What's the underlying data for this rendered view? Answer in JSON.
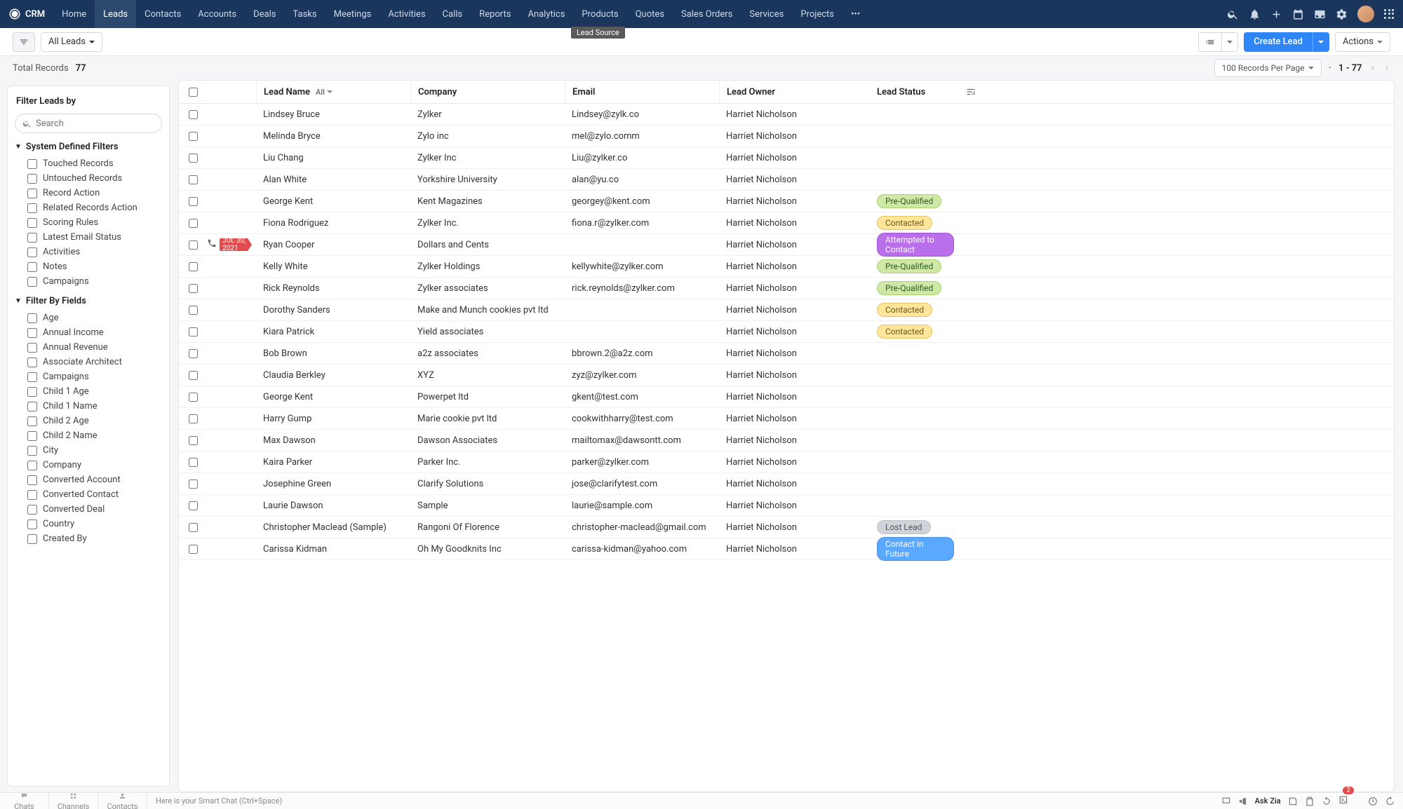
{
  "brand": "CRM",
  "nav": [
    "Home",
    "Leads",
    "Contacts",
    "Accounts",
    "Deals",
    "Tasks",
    "Meetings",
    "Activities",
    "Calls",
    "Reports",
    "Analytics",
    "Products",
    "Quotes",
    "Sales Orders",
    "Services",
    "Projects"
  ],
  "nav_active": 1,
  "tooltip": "Lead Source",
  "toolbar": {
    "view": "All Leads",
    "create": "Create Lead",
    "actions": "Actions"
  },
  "records_label": "Total Records",
  "records_count": "77",
  "perpage": "100 Records Per Page",
  "range": "1 - 77",
  "sidebar": {
    "title": "Filter Leads by",
    "search_placeholder": "Search",
    "group1": "System Defined Filters",
    "group1_items": [
      "Touched Records",
      "Untouched Records",
      "Record Action",
      "Related Records Action",
      "Scoring Rules",
      "Latest Email Status",
      "Activities",
      "Notes",
      "Campaigns"
    ],
    "group2": "Filter By Fields",
    "group2_items": [
      "Age",
      "Annual Income",
      "Annual Revenue",
      "Associate Architect",
      "Campaigns",
      "Child 1 Age",
      "Child 1 Name",
      "Child 2 Age",
      "Child 2 Name",
      "City",
      "Company",
      "Converted Account",
      "Converted Contact",
      "Converted Deal",
      "Country",
      "Created By"
    ]
  },
  "columns": {
    "name": "Lead Name",
    "all": "All",
    "company": "Company",
    "email": "Email",
    "owner": "Lead Owner",
    "status": "Lead Status"
  },
  "rows": [
    {
      "name": "Lindsey Bruce",
      "company": "Zylker",
      "email": "Lindsey@zylk.co",
      "owner": "Harriet Nicholson",
      "status": null
    },
    {
      "name": "Melinda Bryce",
      "company": "Zylo inc",
      "email": "mel@zylo.comm",
      "owner": "Harriet Nicholson",
      "status": null
    },
    {
      "name": "Liu Chang",
      "company": "Zylker Inc",
      "email": "Liu@zylker.co",
      "owner": "Harriet Nicholson",
      "status": null
    },
    {
      "name": "Alan White",
      "company": "Yorkshire University",
      "email": "alan@yu.co",
      "owner": "Harriet Nicholson",
      "status": null
    },
    {
      "name": "George Kent",
      "company": "Kent Magazines",
      "email": "georgey@kent.com",
      "owner": "Harriet Nicholson",
      "status": "Pre-Qualified"
    },
    {
      "name": "Fiona Rodriguez",
      "company": "Zylker Inc.",
      "email": "fiona.r@zylker.com",
      "owner": "Harriet Nicholson",
      "status": "Contacted"
    },
    {
      "name": "Ryan Cooper",
      "company": "Dollars and Cents",
      "email": "",
      "owner": "Harriet Nicholson",
      "status": "Attempted to Contact",
      "flag": "JUL 30, 2021",
      "phone": true
    },
    {
      "name": "Kelly White",
      "company": "Zylker Holdings",
      "email": "kellywhite@zylker.com",
      "owner": "Harriet Nicholson",
      "status": "Pre-Qualified"
    },
    {
      "name": "Rick Reynolds",
      "company": "Zylker associates",
      "email": "rick.reynolds@zylker.com",
      "owner": "Harriet Nicholson",
      "status": "Pre-Qualified"
    },
    {
      "name": "Dorothy Sanders",
      "company": "Make and Munch cookies pvt ltd",
      "email": "",
      "owner": "Harriet Nicholson",
      "status": "Contacted"
    },
    {
      "name": "Kiara Patrick",
      "company": "Yield associates",
      "email": "",
      "owner": "Harriet Nicholson",
      "status": "Contacted"
    },
    {
      "name": "Bob Brown",
      "company": "a2z associates",
      "email": "bbrown.2@a2z.com",
      "owner": "Harriet Nicholson",
      "status": null
    },
    {
      "name": "Claudia Berkley",
      "company": "XYZ",
      "email": "zyz@zylker.com",
      "owner": "Harriet Nicholson",
      "status": null
    },
    {
      "name": "George Kent",
      "company": "Powerpet ltd",
      "email": "gkent@test.com",
      "owner": "Harriet Nicholson",
      "status": null
    },
    {
      "name": "Harry Gump",
      "company": "Marie cookie pvt ltd",
      "email": "cookwithharry@test.com",
      "owner": "Harriet Nicholson",
      "status": null
    },
    {
      "name": "Max Dawson",
      "company": "Dawson Associates",
      "email": "mailtomax@dawsontt.com",
      "owner": "Harriet Nicholson",
      "status": null
    },
    {
      "name": "Kaira Parker",
      "company": "Parker Inc.",
      "email": "parker@zylker.com",
      "owner": "Harriet Nicholson",
      "status": null
    },
    {
      "name": "Josephine Green",
      "company": "Clarify Solutions",
      "email": "jose@clarifytest.com",
      "owner": "Harriet Nicholson",
      "status": null
    },
    {
      "name": "Laurie Dawson",
      "company": "Sample",
      "email": "laurie@sample.com",
      "owner": "Harriet Nicholson",
      "status": null
    },
    {
      "name": "Christopher Maclead (Sample)",
      "company": "Rangoni Of Florence",
      "email": "christopher-maclead@gmail.com",
      "owner": "Harriet Nicholson",
      "status": "Lost Lead"
    },
    {
      "name": "Carissa Kidman",
      "company": "Oh My Goodknits Inc",
      "email": "carissa-kidman@yahoo.com",
      "owner": "Harriet Nicholson",
      "status": "Contact in Future"
    }
  ],
  "status_map": {
    "Pre-Qualified": "b-pre",
    "Contacted": "b-cont",
    "Attempted to Contact": "b-att",
    "Lost Lead": "b-lost",
    "Contact in Future": "b-fut"
  },
  "bottombar": {
    "tabs": [
      "Chats",
      "Channels",
      "Contacts"
    ],
    "smart": "Here is your Smart Chat (Ctrl+Space)",
    "ask": "Ask Zia",
    "badge": "2"
  }
}
